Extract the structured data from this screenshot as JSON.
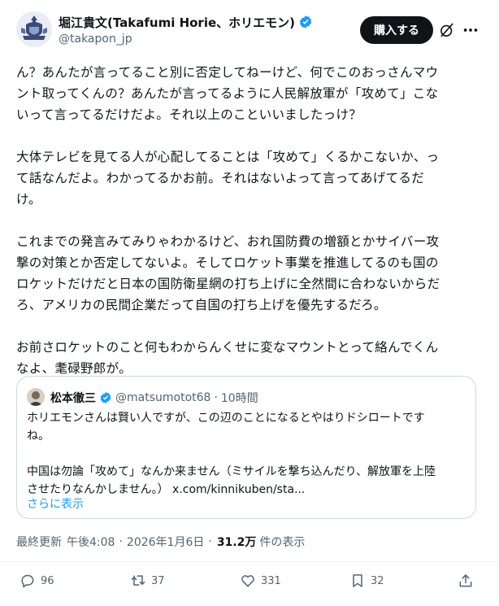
{
  "header": {
    "display_name": "堀江貴文(Takafumi Horie、ホリエモン)",
    "handle": "@takapon_jp",
    "buy_label": "購入する"
  },
  "tweet": {
    "text": "ん？あんたが言ってること別に否定してねーけど、何でこのおっさんマウ\nント取ってくんの？あんたが言ってるように人民解放軍が「攻めて」こな\nいって言ってるだけだよ。それ以上のこといいましたっけ？\n\n大体テレビを見てる人が心配してることは「攻めて」くるかこないか、っ\nて話なんだよ。わかってるかお前。それはないよって言ってあげてるだ\nけ。\n\nこれまでの発言みてみりゃわかるけど、おれ国防費の増額とかサイバー攻\n撃の対策とか否定してないよ。そしてロケット事業を推進してるのも国の\nロケットだけだと日本の国防衛星網の打ち上げに全然間に合わないからだ\nろ、アメリカの民間企業だって自国の打ち上げを優先するだろ。\n\nお前さロケットのこと何もわからんくせに変なマウントとって絡んでくん\nなよ、耄碌野郎が。"
  },
  "quote": {
    "name": "松本徹三",
    "handle": "@matsumotot68",
    "separator": "·",
    "time": "10時間",
    "text": "ホリエモンさんは賢い人ですが、この辺のことになるとやはりドシロートです\nね。\n\n中国は勿論「攻めて」なんか来ません（ミサイルを撃ち込んだり、解放軍を上陸\nさせたりなんかしません。） x.com/kinnikuben/sta...",
    "show_more": "さらに表示"
  },
  "meta": {
    "label": "最終更新",
    "time": "午後4:08",
    "separator": "·",
    "date": "2026年1月6日",
    "separator2": "·",
    "views": "31.2万",
    "views_label": "件の表示"
  },
  "actions": {
    "replies": "96",
    "reposts": "37",
    "likes": "331",
    "bookmarks": "32"
  },
  "colors": {
    "text": "#0f1419",
    "secondary": "#536471",
    "link": "#1d9bf0",
    "verified": "#1d9bf0",
    "border": "#cfd9de"
  }
}
